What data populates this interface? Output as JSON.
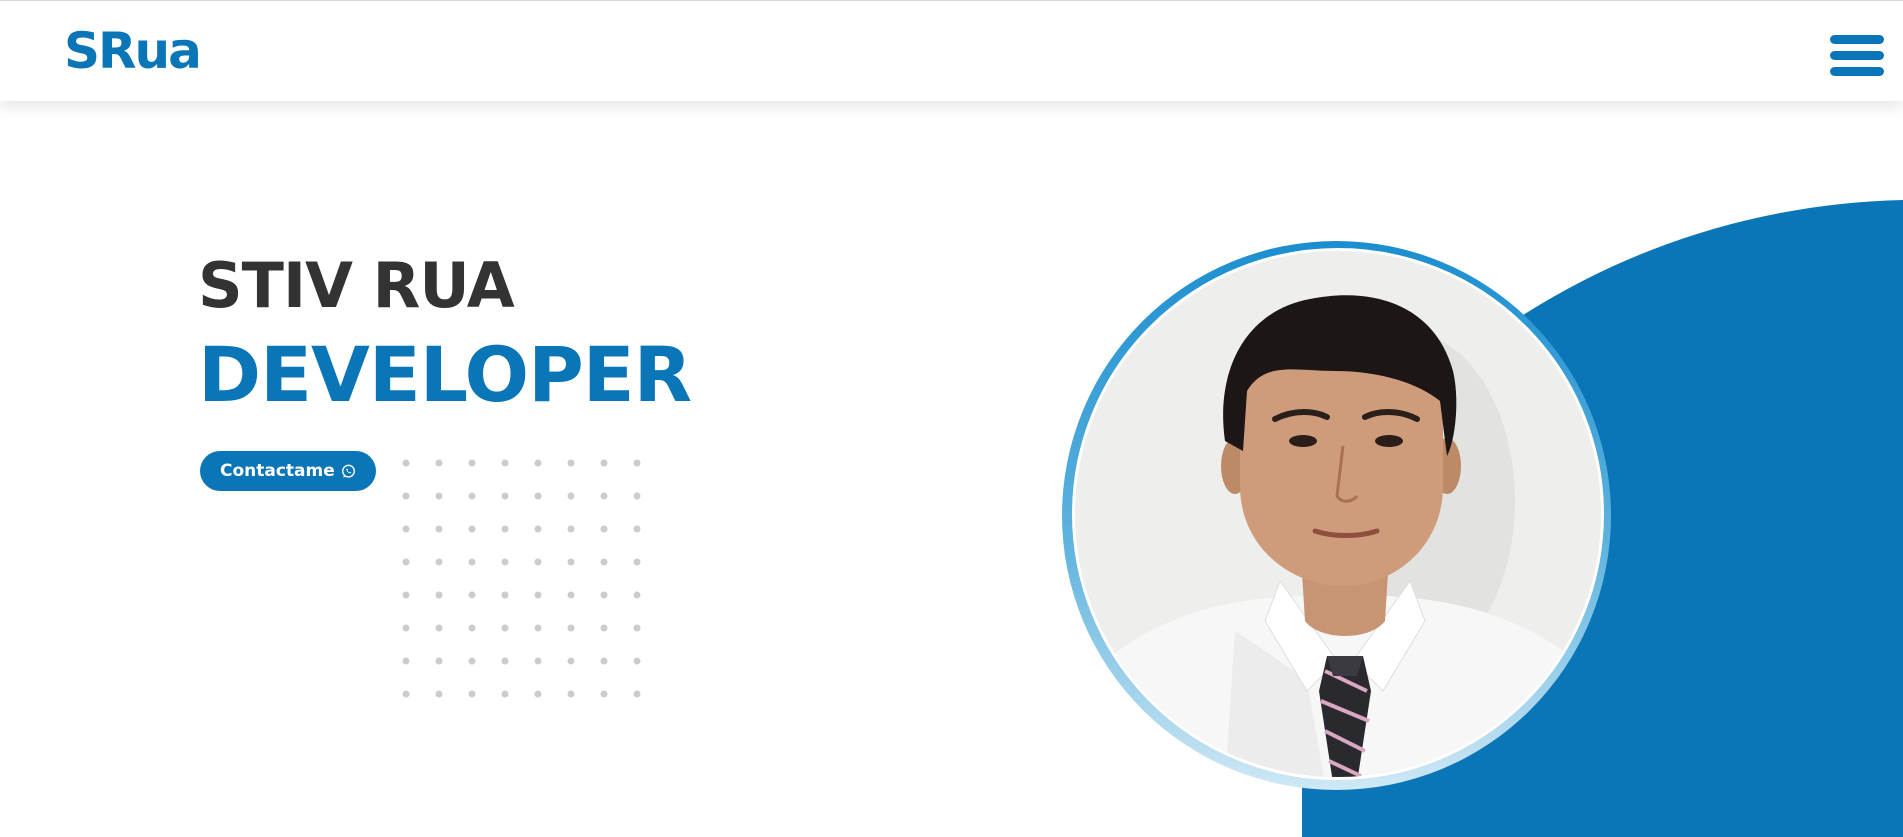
{
  "header": {
    "logo_text": "SRua",
    "menu_icon": "hamburger-menu-icon"
  },
  "hero": {
    "name": "STIV RUA",
    "role": "DEVELOPER",
    "contact_label": "Contactame",
    "contact_icon": "whatsapp-icon"
  },
  "portrait": {
    "icon": "profile-photo"
  },
  "colors": {
    "brand_blue": "#0a76b8",
    "heading_dark": "#333333",
    "dot_gray": "#cccccc",
    "background": "#ffffff"
  }
}
